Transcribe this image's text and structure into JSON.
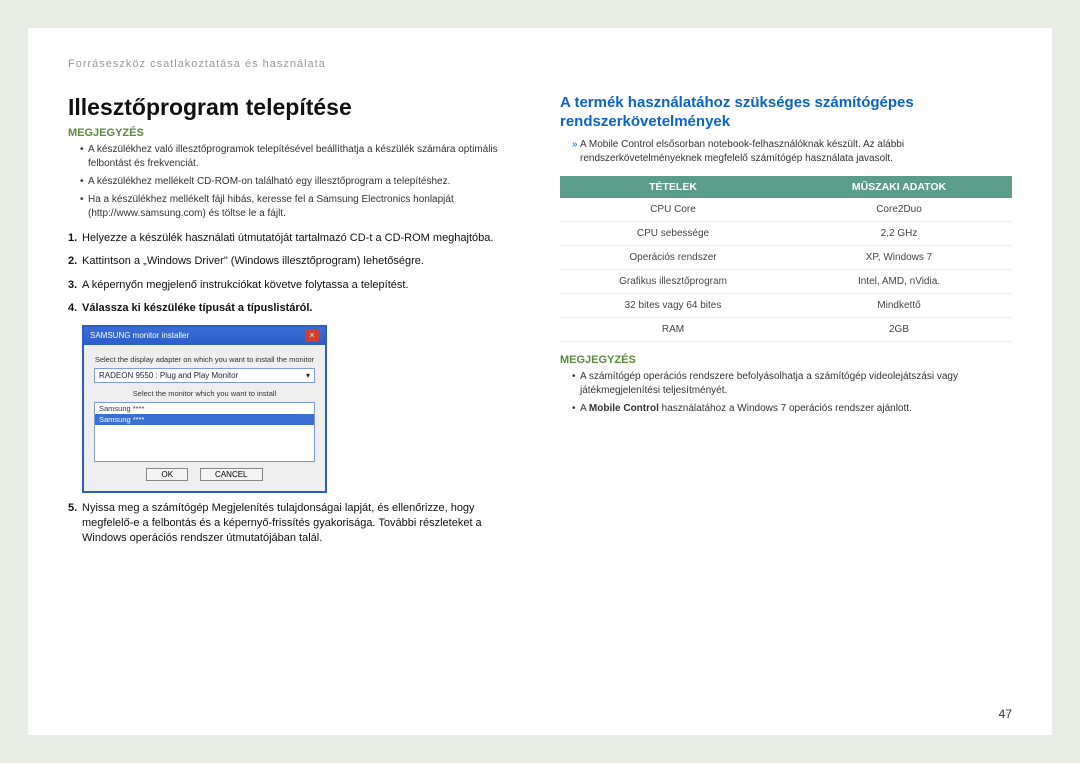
{
  "breadcrumb": "Forráseszköz csatlakoztatása és használata",
  "left": {
    "title": "Illesztőprogram telepítése",
    "note_label": "MEGJEGYZÉS",
    "bullets": [
      "A készülékhez való illesztőprogramok telepítésével beállíthatja a készülék számára optimális felbontást és frekvenciát.",
      "A készülékhez mellékelt CD-ROM-on található egy illesztőprogram a telepítéshez.",
      "Ha a készülékhez mellékelt fájl hibás, keresse fel a Samsung Electronics honlapját (http://www.samsung.com) és töltse le a fájlt."
    ],
    "steps": [
      "Helyezze a készülék használati útmutatóját tartalmazó CD-t a CD-ROM meghajtóba.",
      "Kattintson a „Windows Driver\" (Windows illesztőprogram) lehetőségre.",
      "A képernyőn megjelenő instrukciókat követve folytassa a telepítést.",
      "Válassza ki készüléke típusát a típuslistáról.",
      "Nyissa meg a számítógép Megjelenítés tulajdonságai lapját, és ellenőrizze, hogy megfelelő-e a felbontás és a képernyő-frissítés gyakorisága. További részleteket a Windows operációs rendszer útmutatójában talál."
    ],
    "installer": {
      "title": "SAMSUNG monitor installer",
      "text1": "Select the display adapter on which you want to install the monitor",
      "adapter": "RADEON 9550 : Plug and Play Monitor",
      "text2": "Select the monitor which you want to install",
      "row1": "Samsung ****",
      "row2": "Samsung ****",
      "ok": "OK",
      "cancel": "CANCEL"
    }
  },
  "right": {
    "title": "A termék használatához szükséges számítógépes rendszerkövetelmények",
    "intro": "A Mobile Control elsősorban notebook-felhasználóknak készült. Az alábbi rendszerkövetelményeknek megfelelő számítógép használata javasolt.",
    "headers": [
      "TÉTELEK",
      "MŰSZAKI ADATOK"
    ],
    "rows": [
      [
        "CPU Core",
        "Core2Duo"
      ],
      [
        "CPU sebessége",
        "2,2 GHz"
      ],
      [
        "Operációs rendszer",
        "XP, Windows 7"
      ],
      [
        "Grafikus illesztőprogram",
        "Intel, AMD, nVidia."
      ],
      [
        "32 bites vagy 64 bites",
        "Mindkettő"
      ],
      [
        "RAM",
        "2GB"
      ]
    ],
    "note_label": "MEGJEGYZÉS",
    "notes": [
      "A számítógép operációs rendszere befolyásolhatja a számítógép videolejátszási vagy játékmegjelenítési teljesítményét."
    ],
    "note_bold_pre": "A ",
    "note_bold": "Mobile Control",
    "note_bold_post": " használatához a Windows 7 operációs rendszer ajánlott."
  },
  "page_number": "47"
}
